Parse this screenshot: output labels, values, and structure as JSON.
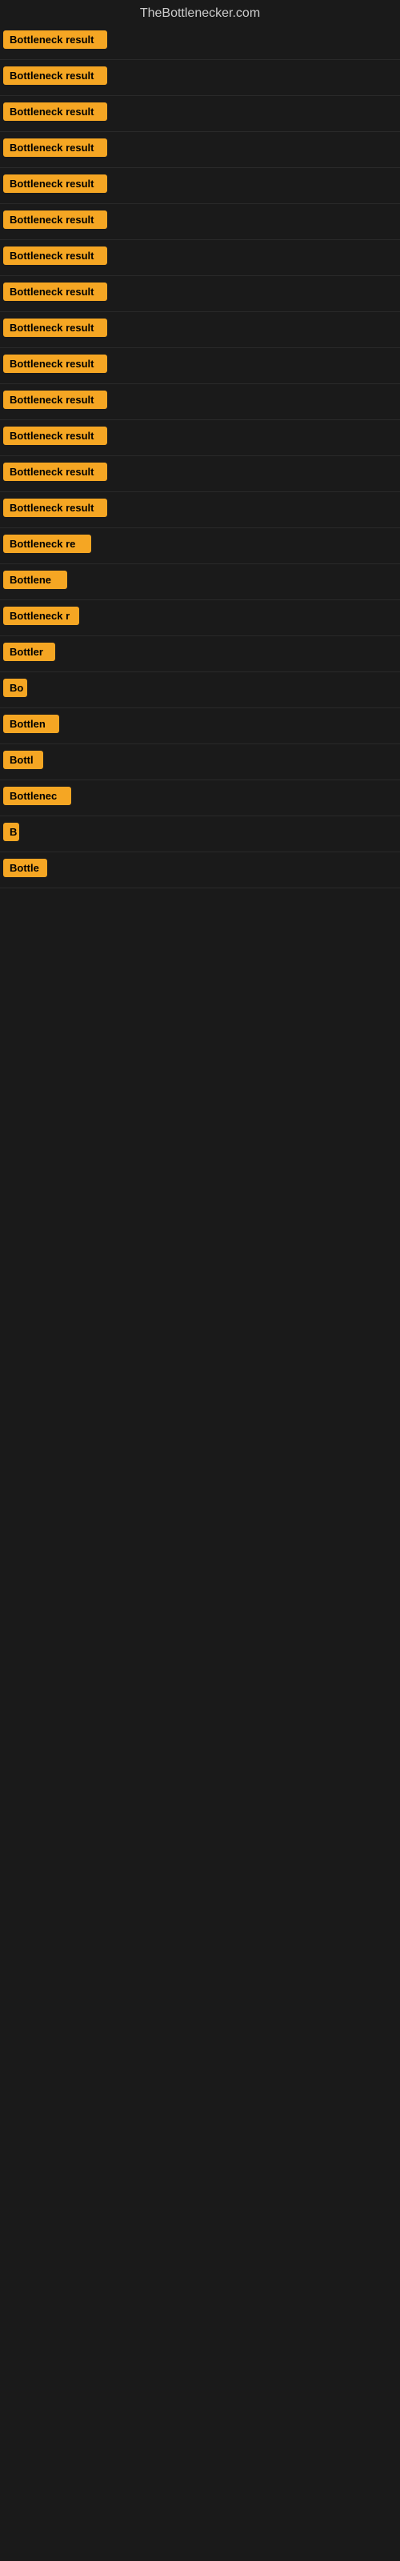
{
  "site": {
    "title": "TheBottlenecker.com"
  },
  "results": [
    {
      "id": 1,
      "label": "Bottleneck result",
      "width": 130
    },
    {
      "id": 2,
      "label": "Bottleneck result",
      "width": 130
    },
    {
      "id": 3,
      "label": "Bottleneck result",
      "width": 130
    },
    {
      "id": 4,
      "label": "Bottleneck result",
      "width": 130
    },
    {
      "id": 5,
      "label": "Bottleneck result",
      "width": 130
    },
    {
      "id": 6,
      "label": "Bottleneck result",
      "width": 130
    },
    {
      "id": 7,
      "label": "Bottleneck result",
      "width": 130
    },
    {
      "id": 8,
      "label": "Bottleneck result",
      "width": 130
    },
    {
      "id": 9,
      "label": "Bottleneck result",
      "width": 130
    },
    {
      "id": 10,
      "label": "Bottleneck result",
      "width": 130
    },
    {
      "id": 11,
      "label": "Bottleneck result",
      "width": 130
    },
    {
      "id": 12,
      "label": "Bottleneck result",
      "width": 130
    },
    {
      "id": 13,
      "label": "Bottleneck result",
      "width": 130
    },
    {
      "id": 14,
      "label": "Bottleneck result",
      "width": 130
    },
    {
      "id": 15,
      "label": "Bottleneck re",
      "width": 110
    },
    {
      "id": 16,
      "label": "Bottlene",
      "width": 80
    },
    {
      "id": 17,
      "label": "Bottleneck r",
      "width": 95
    },
    {
      "id": 18,
      "label": "Bottler",
      "width": 65
    },
    {
      "id": 19,
      "label": "Bo",
      "width": 30
    },
    {
      "id": 20,
      "label": "Bottlen",
      "width": 70
    },
    {
      "id": 21,
      "label": "Bottl",
      "width": 50
    },
    {
      "id": 22,
      "label": "Bottlenec",
      "width": 85
    },
    {
      "id": 23,
      "label": "B",
      "width": 20
    },
    {
      "id": 24,
      "label": "Bottle",
      "width": 55
    }
  ]
}
